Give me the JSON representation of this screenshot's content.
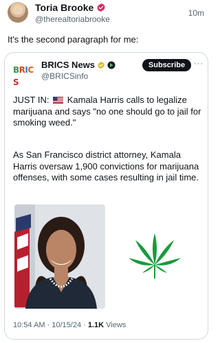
{
  "author": {
    "display_name": "Toria Brooke",
    "handle": "@therealtoriabrooke",
    "time_ago": "10m"
  },
  "post_text": "It's the second paragraph for me:",
  "quoted": {
    "logo_text": "BRICS",
    "display_name": "BRICS News",
    "handle": "@BRICSinfo",
    "subscribe_label": "Subscribe",
    "more_label": "···",
    "text_prefix": "JUST IN:",
    "text_1_body": "Kamala Harris calls to legalize marijuana and says \"no one should go to jail for smoking weed.\"",
    "text_2": "As San Francisco district attorney, Kamala Harris oversaw 1,900 convictions for marijuana offenses, with some cases resulting in jail time.",
    "timestamp": "10:54 AM · 10/15/24 · ",
    "views_count": "1.1K",
    "views_label": " Views"
  },
  "colors": {
    "text_primary": "#0f1419",
    "text_secondary": "#536471",
    "border": "#cfd9de",
    "verified_pink": "#e0245e",
    "verified_gold": "#e2b719",
    "leaf_green": "#1a9a3a"
  }
}
